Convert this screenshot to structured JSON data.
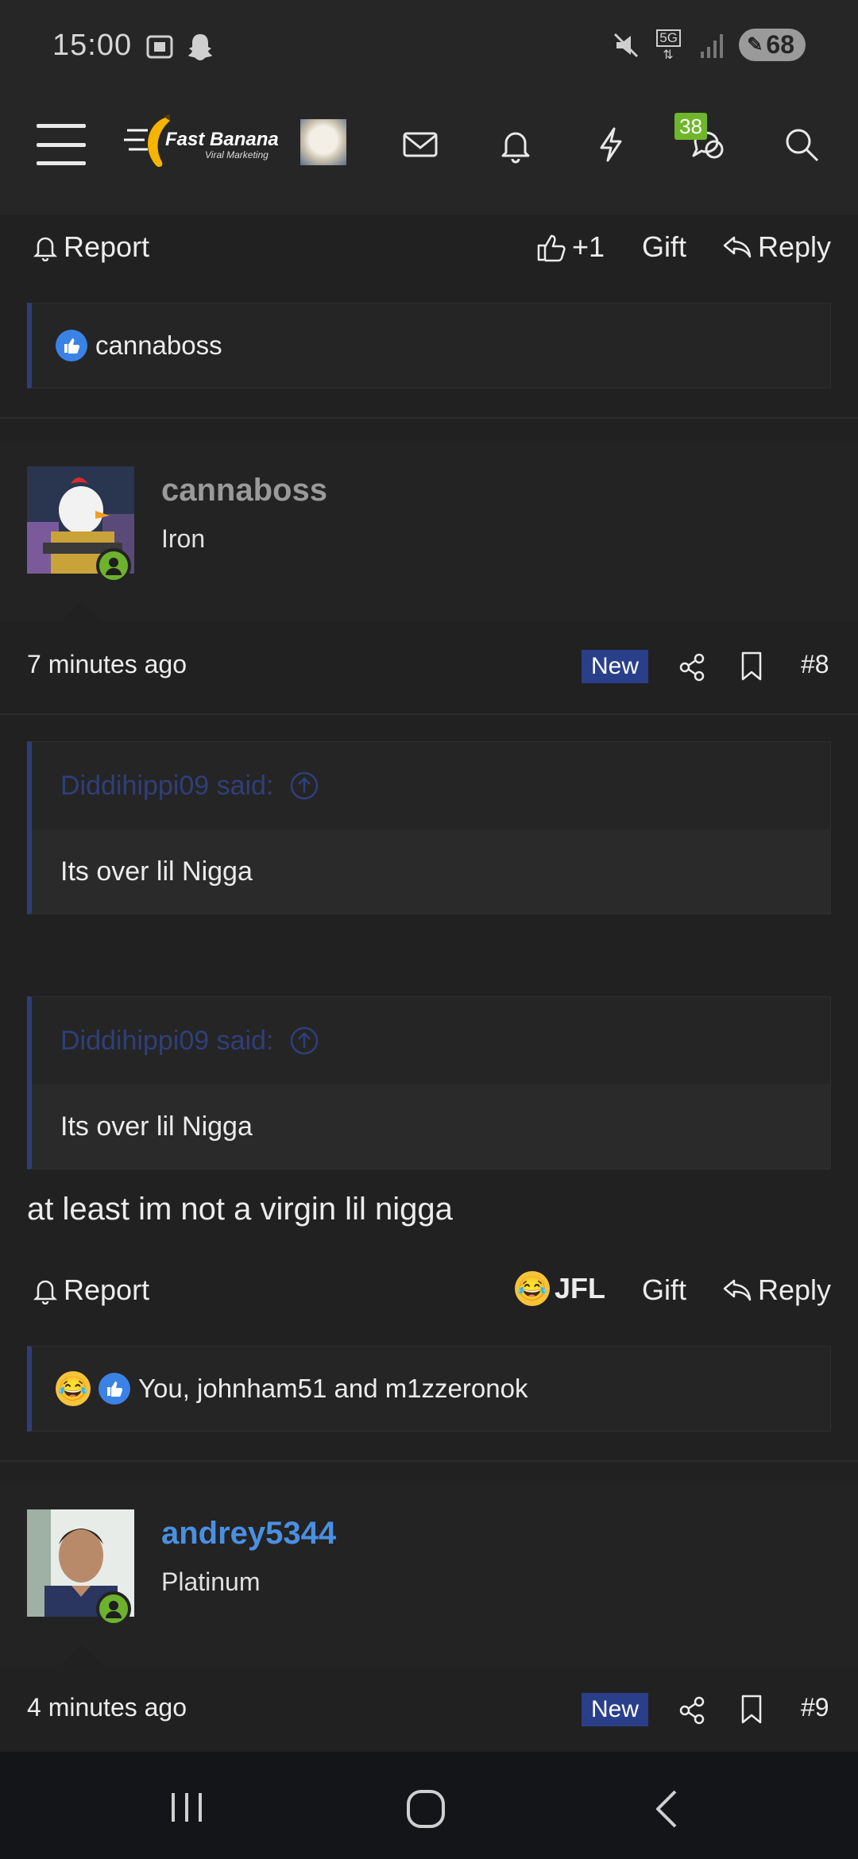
{
  "status_bar": {
    "time": "15:00",
    "network": "5G",
    "battery": "68",
    "icons": [
      "screenshot-icon",
      "snapchat-icon",
      "mute-icon",
      "signal-icon",
      "battery-icon"
    ]
  },
  "nav": {
    "logo_title": "Fast Banana",
    "logo_subtitle": "Viral Marketing",
    "alerts_badge": "38",
    "icons": [
      "menu-icon",
      "mail-icon",
      "bell-icon",
      "lightning-icon",
      "chat-icon",
      "search-icon"
    ]
  },
  "top_actions": {
    "report": "Report",
    "like": "+1",
    "gift": "Gift",
    "reply": "Reply"
  },
  "top_reactions": {
    "users": "cannaboss"
  },
  "post8": {
    "username": "cannaboss",
    "user_title": "Iron",
    "time": "7 minutes ago",
    "badge": "New",
    "number": "#8",
    "quotes": [
      {
        "author": "Diddihippi09 said:",
        "text": "Its over lil Nigga"
      },
      {
        "author": "Diddihippi09 said:",
        "text": "Its over lil Nigga"
      }
    ],
    "body": "at least im not a virgin lil nigga",
    "actions": {
      "report": "Report",
      "reaction": "JFL",
      "gift": "Gift",
      "reply": "Reply"
    },
    "reactions_users": "You, johnham51 and m1zzeronok"
  },
  "post9": {
    "username": "andrey5344",
    "user_title": "Platinum",
    "time": "4 minutes ago",
    "badge": "New",
    "number": "#9"
  },
  "colors": {
    "accent_blue": "#4a90e2",
    "quote_border": "#2f3e78",
    "online_green": "#6cb22d",
    "badge_green": "#6fb62c"
  }
}
